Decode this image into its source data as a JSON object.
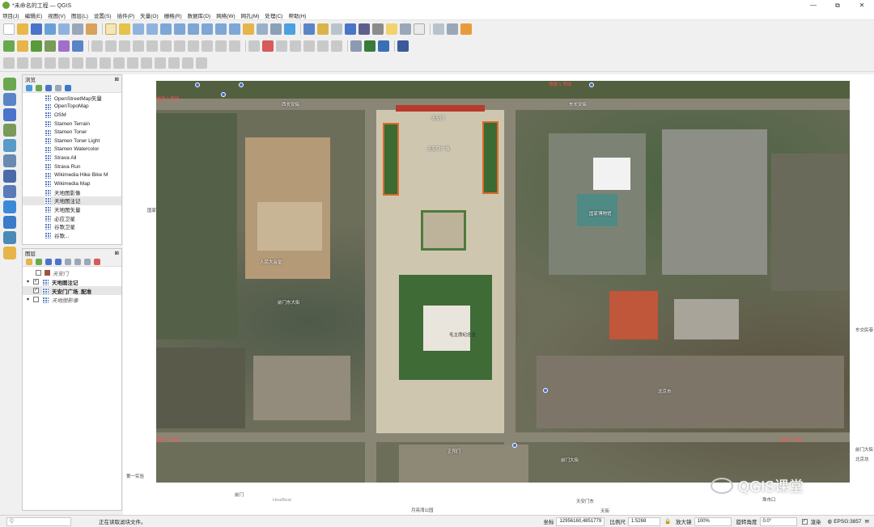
{
  "window": {
    "title": "*未命名的工程 — QGIS",
    "controls": [
      "—",
      "⧉",
      "✕"
    ]
  },
  "menu": [
    "项目(J)",
    "编辑(E)",
    "视图(V)",
    "图层(L)",
    "设置(S)",
    "插件(P)",
    "矢量(O)",
    "栅格(R)",
    "数据库(D)",
    "网络(W)",
    "网孔(M)",
    "处理(C)",
    "帮助(H)"
  ],
  "browser": {
    "title": "浏览",
    "items": [
      "OpenStreetMap矢量",
      "OpenTopoMap",
      "OSM",
      "Stamen Terrain",
      "Stamen Toner",
      "Stamen Toner Light",
      "Stamen Watercolor",
      "Strava All",
      "Strava Run",
      "Wikimedia Hike Bike M",
      "Wikimedia Map",
      "天地图影像",
      "天地图注记",
      "天地图矢量",
      "必应卫星",
      "谷歌卫星",
      "谷歌..."
    ],
    "selected_index": 12
  },
  "layers": {
    "title": "图层",
    "items": [
      {
        "name": "天安门",
        "checked": false,
        "style": "italic",
        "color": "#a0523d"
      },
      {
        "name": "天地图注记",
        "checked": true,
        "style": "bold"
      },
      {
        "name": "天安门广场_配准",
        "checked": true,
        "style": "bold"
      },
      {
        "name": "天地图影像",
        "checked": false,
        "style": "italic"
      }
    ]
  },
  "map": {
    "labels": [
      "西长安街",
      "东长安街",
      "天安门",
      "天安门广场",
      "毛主席纪念堂",
      "前门东大街",
      "正阳门",
      "人民大会堂",
      "国家博物馆",
      "北京市",
      "前门大街"
    ],
    "red_labels": [
      "地铁 1 号线",
      "地铁 1 号线",
      "地铁 2 号线",
      "地铁 2 号线"
    ],
    "outside_labels": [
      "国家大剧院",
      "东交民巷",
      "前门大街",
      "北京坊",
      "月亮湾公园",
      "天安门东",
      "第一实验",
      "前门",
      "珠市口",
      "天街",
      "HeatBeat"
    ]
  },
  "watermark": "QGIS课堂",
  "status": {
    "search_placeholder": "Q",
    "message": "正在读取滤块文件。",
    "coord_label": "坐标",
    "coord_value": "12956160,4851779",
    "scale_label": "比例尺",
    "scale_value": "1:5268",
    "magnifier_label": "放大镜",
    "magnifier_value": "100%",
    "rotation_label": "旋转角度",
    "rotation_value": "0.0°",
    "render_label": "渲染",
    "crs": "EPSG:3857"
  }
}
